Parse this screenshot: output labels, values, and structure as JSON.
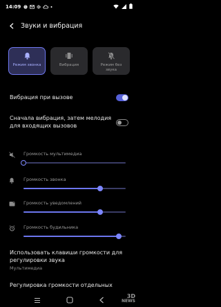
{
  "status_bar": {
    "time": "14:09",
    "icons": [
      "notification-g-icon",
      "mail-icon",
      "gear-icon",
      "cloud-icon",
      "dot-icon",
      "wifi-icon",
      "signal-icon",
      "battery-icon"
    ]
  },
  "header": {
    "title": "Звуки и вибрация",
    "back_icon": "arrow-left-icon"
  },
  "modes": [
    {
      "label": "Режим звонка",
      "icon": "bell-icon",
      "active": true
    },
    {
      "label": "Вибрация",
      "icon": "vibrate-icon",
      "active": false
    },
    {
      "label": "Режим без звука",
      "icon": "bell-off-icon",
      "active": false
    }
  ],
  "settings": {
    "vibrate_on_call": {
      "label": "Вибрация при вызове",
      "on": true
    },
    "vibrate_then_ring": {
      "label": "Сначала вибрация, затем мелодия для входящих вызовов",
      "on": false
    }
  },
  "volumes": [
    {
      "label": "Громкость мультимедиа",
      "icon": "speaker-muted-icon",
      "level": 0.0
    },
    {
      "label": "Громкость звонка",
      "icon": "bell-icon",
      "level": 0.75
    },
    {
      "label": "Громкость уведомлений",
      "icon": "notification-icon",
      "level": 0.75
    },
    {
      "label": "Громкость будильника",
      "icon": "alarm-icon",
      "level": 0.93
    }
  ],
  "volume_keys": {
    "title": "Использовать клавиши громкости для регулировки звука",
    "subtitle": "Мультимедиа"
  },
  "separate_volume": {
    "title": "Регулировка громкости отдельных"
  },
  "nav_bar": {
    "icons": [
      "menu-icon",
      "home-icon",
      "back-icon"
    ]
  },
  "watermark": {
    "line1": "3D",
    "line2": "NEWS"
  },
  "colors": {
    "accent": "#6c76ee",
    "background": "#000000",
    "card": "#2a2a2d"
  }
}
